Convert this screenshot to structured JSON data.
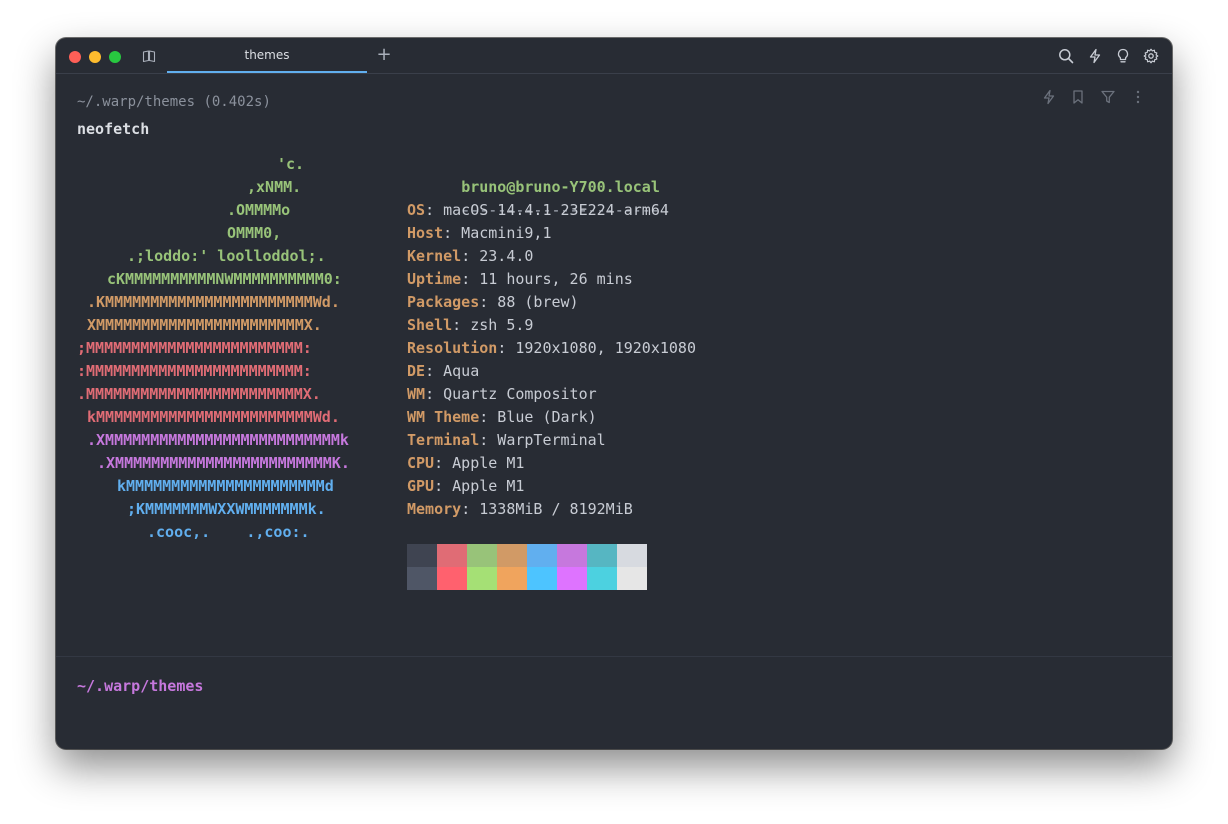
{
  "window": {
    "tab_title": "themes",
    "new_tab_label": "+"
  },
  "block": {
    "prompt_path": "~/.warp/themes",
    "duration": "(0.402s)",
    "command": "neofetch"
  },
  "logo_lines": [
    {
      "text": "'c.",
      "color": "#98c379",
      "indent": 20
    },
    {
      "text": ",xNMM.",
      "color": "#98c379",
      "indent": 17
    },
    {
      "text": ".OMMMMo",
      "color": "#98c379",
      "indent": 15
    },
    {
      "text": "OMMM0,",
      "color": "#98c379",
      "indent": 15
    },
    {
      "text": ".;loddo:' loolloddol;.",
      "color": "#98c379",
      "indent": 5
    },
    {
      "text": "cKMMMMMMMMMMNWMMMMMMMMMM0:",
      "color": "#98c379",
      "indent": 3
    },
    {
      "text": ".KMMMMMMMMMMMMMMMMMMMMMMMWd.",
      "color": "#d19a66",
      "indent": 1
    },
    {
      "text": "XMMMMMMMMMMMMMMMMMMMMMMMX.",
      "color": "#d19a66",
      "indent": 1
    },
    {
      "text": ";MMMMMMMMMMMMMMMMMMMMMMMM:",
      "color": "#e06c75",
      "indent": 0
    },
    {
      "text": ":MMMMMMMMMMMMMMMMMMMMMMMM:",
      "color": "#e06c75",
      "indent": 0
    },
    {
      "text": ".MMMMMMMMMMMMMMMMMMMMMMMMX.",
      "color": "#e06c75",
      "indent": 0
    },
    {
      "text": "kMMMMMMMMMMMMMMMMMMMMMMMMWd.",
      "color": "#e06c75",
      "indent": 1
    },
    {
      "text": ".XMMMMMMMMMMMMMMMMMMMMMMMMMMk",
      "color": "#c678dd",
      "indent": 1
    },
    {
      "text": ".XMMMMMMMMMMMMMMMMMMMMMMMMK.",
      "color": "#c678dd",
      "indent": 2
    },
    {
      "text": "kMMMMMMMMMMMMMMMMMMMMMMd",
      "color": "#61afef",
      "indent": 4
    },
    {
      "text": ";KMMMMMMMWXXWMMMMMMMk.",
      "color": "#61afef",
      "indent": 5
    },
    {
      "text": ".cooc,.    .,coo:.",
      "color": "#61afef",
      "indent": 7
    }
  ],
  "info": {
    "userhost": "bruno@bruno-Y700.local",
    "separator": "----------------------",
    "fields": [
      {
        "key": "OS",
        "value": ": macOS 14.4.1 23E224 arm64"
      },
      {
        "key": "Host",
        "value": ": Macmini9,1"
      },
      {
        "key": "Kernel",
        "value": ": 23.4.0"
      },
      {
        "key": "Uptime",
        "value": ": 11 hours, 26 mins"
      },
      {
        "key": "Packages",
        "value": ": 88 (brew)"
      },
      {
        "key": "Shell",
        "value": ": zsh 5.9"
      },
      {
        "key": "Resolution",
        "value": ": 1920x1080, 1920x1080"
      },
      {
        "key": "DE",
        "value": ": Aqua"
      },
      {
        "key": "WM",
        "value": ": Quartz Compositor"
      },
      {
        "key": "WM Theme",
        "value": ": Blue (Dark)"
      },
      {
        "key": "Terminal",
        "value": ": WarpTerminal"
      },
      {
        "key": "CPU",
        "value": ": Apple M1"
      },
      {
        "key": "GPU",
        "value": ": Apple M1"
      },
      {
        "key": "Memory",
        "value": ": 1338MiB / 8192MiB"
      }
    ]
  },
  "palette": {
    "normal": [
      "#3f4451",
      "#e06c75",
      "#98c379",
      "#d19a66",
      "#61afef",
      "#c678dd",
      "#56b6c2",
      "#d7dae0"
    ],
    "bright": [
      "#4f5666",
      "#ff616e",
      "#a5e075",
      "#f0a45d",
      "#4dc4ff",
      "#de73ff",
      "#4cd1e0",
      "#e6e6e6"
    ]
  },
  "input": {
    "prompt_path": "~/.warp/themes"
  }
}
